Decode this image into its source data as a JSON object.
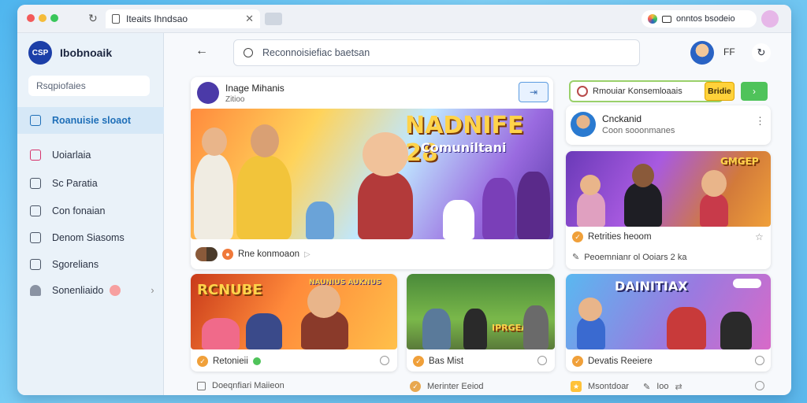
{
  "browser": {
    "tab_title": "Iteaits Ihndsao",
    "address_text": "onntos bsodeio",
    "profile_initial": "",
    "colors": {
      "close": "#f35a5a",
      "minimize": "#f5bc3a",
      "maximize": "#39c65a"
    }
  },
  "sidebar": {
    "brand": "Ibobnoaik",
    "logo_text": "CSP",
    "search_placeholder": "Rsqpiofaies",
    "items": [
      {
        "label": "Roanuisie sloaot",
        "icon": "clipboard-icon",
        "active": true
      },
      {
        "label": "Uoiarlaia",
        "icon": "edit-image-icon"
      },
      {
        "label": "Sc Paratia",
        "icon": "document-icon"
      },
      {
        "label": "Con fonaian",
        "icon": "monitor-icon"
      },
      {
        "label": "Denom Siasoms",
        "icon": "window-icon"
      },
      {
        "label": "Sgorelians",
        "icon": "list-icon"
      },
      {
        "label": "Sonenliaido",
        "icon": "user-icon"
      }
    ]
  },
  "header": {
    "search_placeholder": "Reconnoisiefiac baetsan",
    "user_label": "FF"
  },
  "featured": {
    "title": "Inage Mihanis",
    "subtitle": "Zitioo",
    "action_icon": "compare-icon",
    "overlay_title": "NADNIFE 28",
    "overlay_sub": "Comuniltani",
    "meta_label": "Rne konmoaon"
  },
  "promo": {
    "input_text": "Rmouiar Konsemloaais",
    "button_label": "Bridie",
    "go_icon": "chevron-right-icon"
  },
  "creator": {
    "name": "Cnckanid",
    "subtitle": "Coon sooonmanes"
  },
  "right_card": {
    "overlay": "GMGEP",
    "title": "Retrities heoom",
    "meta": "Peoemnianr ol Ooiars 2 ka"
  },
  "grid": [
    {
      "overlay": "RCNUBE",
      "overlay_sub": "NAUNIUS AUKNUS",
      "title": "Retonieii",
      "footer": "Doeqnfiari Maiieon"
    },
    {
      "overlay": "IPRGEAID",
      "title": "Bas Mist",
      "footer": "Merinter Eeiod"
    },
    {
      "overlay": "DAINITIAX",
      "title": "Devatis Reeiere",
      "footer_a": "Msontdoar",
      "footer_b": "Ioo"
    }
  ]
}
